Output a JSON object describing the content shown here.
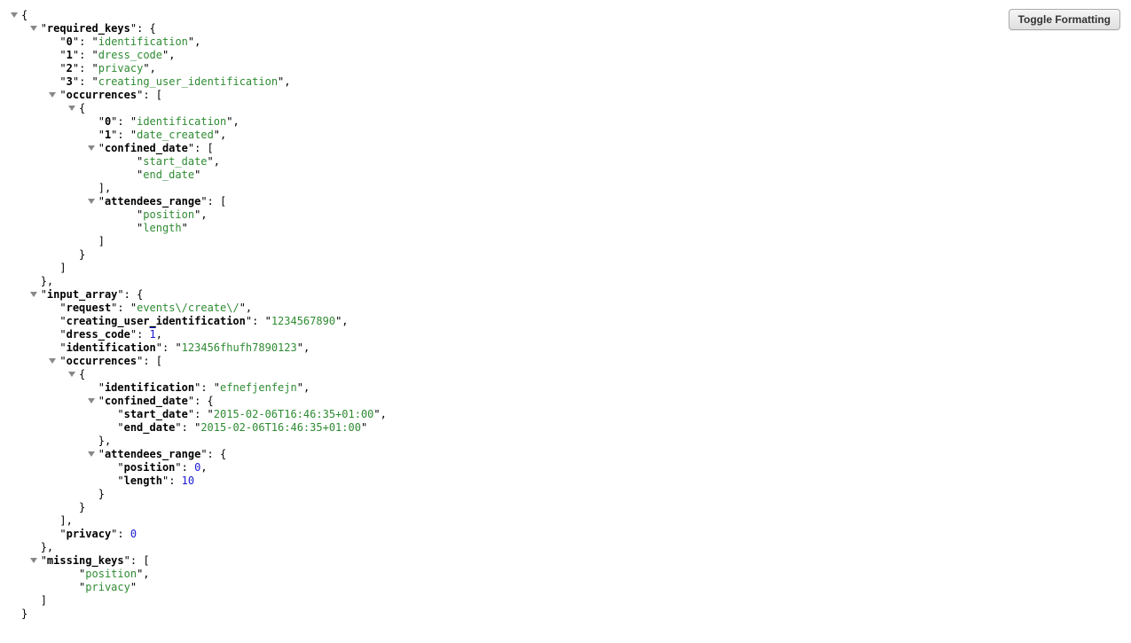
{
  "buttons": {
    "toggle_formatting": "Toggle Formatting"
  },
  "json": {
    "required_keys": {
      "0": "identification",
      "1": "dress_code",
      "2": "privacy",
      "3": "creating_user_identification",
      "occurrences": [
        {
          "0": "identification",
          "1": "date_created",
          "confined_date": [
            "start_date",
            "end_date"
          ],
          "attendees_range": [
            "position",
            "length"
          ]
        }
      ]
    },
    "input_array": {
      "request": "events\\/create\\/",
      "creating_user_identification": "1234567890",
      "dress_code": {
        "__overline__": "1"
      },
      "identification": "123456fhufh7890123",
      "occurrences": [
        {
          "identification": "efnefjenfejn",
          "confined_date": {
            "start_date": "2015-02-06T16:46:35+01:00",
            "end_date": "2015-02-06T16:46:35+01:00"
          },
          "attendees_range": {
            "position": 0,
            "length": 10
          }
        }
      ],
      "privacy": 0
    },
    "missing_keys": [
      "position",
      "privacy"
    ]
  }
}
